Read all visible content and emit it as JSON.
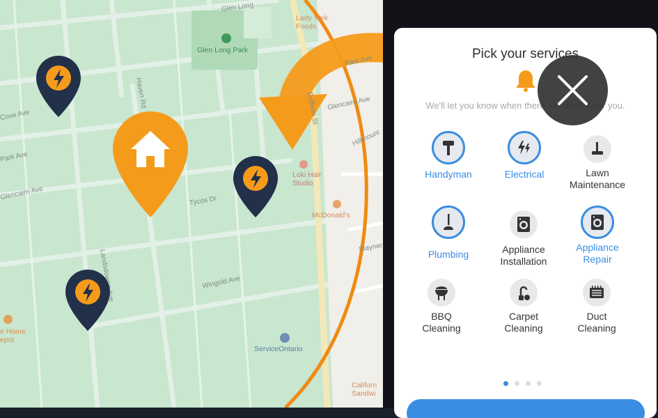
{
  "map": {
    "streets": [
      "Glen Long",
      "Cove Ave",
      "Park Ave",
      "Glencairn Ave",
      "Tycos Dr",
      "Wingold Ave",
      "Landsdowne Ave",
      "Haven Rd",
      "Park Ave",
      "Glencairn Ave",
      "Hillmount",
      "Dufferin St",
      "Stayner"
    ],
    "pois": {
      "lady_york": "Lady York\nFoods",
      "glen_long_park": "Glen Long Park",
      "loki": "Loki Hair\nStudio",
      "mcdonalds": "McDonald's",
      "service_ontario": "ServiceOntario",
      "home_depot": "e Home\nepot",
      "california": "Californ\nSandwi"
    },
    "colors": {
      "background": "#c8e6cf",
      "park": "#b2dcb8",
      "road": "#e2efe6",
      "accent": "#f59b1b",
      "navy": "#23304a"
    }
  },
  "pins": [
    {
      "name": "electric-pin-1",
      "icon": "bolt-icon"
    },
    {
      "name": "home-pin",
      "icon": "home-icon"
    },
    {
      "name": "electric-pin-2",
      "icon": "bolt-icon"
    },
    {
      "name": "electric-pin-3",
      "icon": "bolt-icon"
    }
  ],
  "panel": {
    "title": "Pick your services",
    "subtitle": "We'll let you know when there are deals near you.",
    "bell_icon": "bell-icon",
    "services": [
      {
        "label": "Handyman",
        "icon": "hammer-icon",
        "selected": true
      },
      {
        "label": "Electrical",
        "icon": "bolt-icon",
        "selected": true
      },
      {
        "label": "Lawn\nMaintenance",
        "icon": "lawnmower-icon",
        "selected": false
      },
      {
        "label": "Plumbing",
        "icon": "plunger-icon",
        "selected": true
      },
      {
        "label": "Appliance\nInstallation",
        "icon": "washer-icon",
        "selected": false
      },
      {
        "label": "Appliance\nRepair",
        "icon": "washer-icon",
        "selected": true
      },
      {
        "label": "BBQ\nCleaning",
        "icon": "bbq-icon",
        "selected": false
      },
      {
        "label": "Carpet\nCleaning",
        "icon": "vacuum-icon",
        "selected": false
      },
      {
        "label": "Duct\nCleaning",
        "icon": "vent-icon",
        "selected": false
      }
    ],
    "page_dots": 4,
    "active_page": 1,
    "accent_color": "#3a8de2"
  },
  "close": {
    "icon": "close-icon"
  }
}
